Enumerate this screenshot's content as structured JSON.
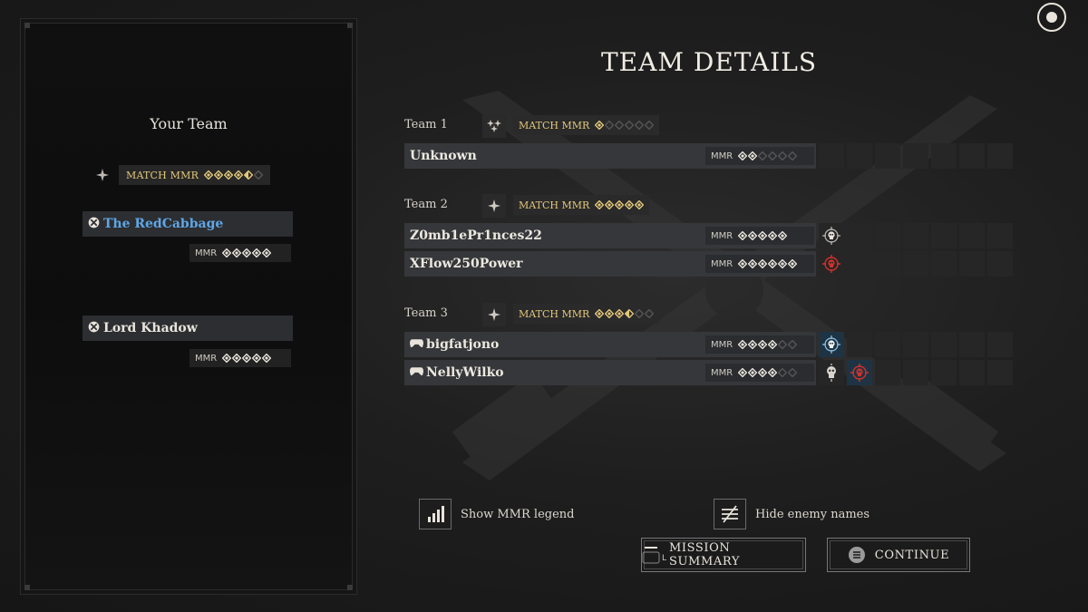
{
  "page": {
    "title": "TEAM DETAILS"
  },
  "your_team": {
    "title": "Your Team",
    "match_mmr_label": "MATCH MMR",
    "match_mmr_stars": 4.5,
    "players": [
      {
        "name": "The RedCabbage",
        "platform": "xbox-icon",
        "highlight": true,
        "mmr_label": "MMR",
        "mmr_stars": 5
      },
      {
        "name": "Lord Khadow",
        "platform": "xbox-icon",
        "highlight": false,
        "mmr_label": "MMR",
        "mmr_stars": 5
      }
    ]
  },
  "teams": [
    {
      "label": "Team 1",
      "match_mmr_label": "MATCH MMR",
      "match_mmr_stars": 1,
      "players": [
        {
          "name": "Unknown",
          "platform": "",
          "mmr_label": "MMR",
          "mmr_stars": 2,
          "slots": []
        }
      ]
    },
    {
      "label": "Team 2",
      "match_mmr_label": "MATCH MMR",
      "match_mmr_stars": 5,
      "players": [
        {
          "name": "Z0mb1ePr1nces22",
          "platform": "",
          "mmr_label": "MMR",
          "mmr_stars": 5,
          "slots": [
            "skull-target-grey-icon"
          ]
        },
        {
          "name": "XFlow250Power",
          "platform": "",
          "mmr_label": "MMR",
          "mmr_stars": 6,
          "slots": [
            "skull-target-red-icon"
          ]
        }
      ]
    },
    {
      "label": "Team 3",
      "match_mmr_label": "MATCH MMR",
      "match_mmr_stars": 3.5,
      "players": [
        {
          "name": "bigfatjono",
          "platform": "gamepad-icon",
          "mmr_label": "MMR",
          "mmr_stars": 4,
          "slots": [
            "skull-target-blue-icon"
          ]
        },
        {
          "name": "NellyWilko",
          "platform": "gamepad-icon",
          "mmr_label": "MMR",
          "mmr_stars": 4,
          "slots": [
            "skull-grey-icon",
            "skull-target-red-icon"
          ]
        }
      ]
    }
  ],
  "toggles": {
    "mmr_legend": {
      "label": "Show MMR legend",
      "icon": "bar-chart-icon"
    },
    "hide_enemy": {
      "label": "Hide enemy names",
      "icon": "list-strike-icon"
    }
  },
  "buttons": {
    "mission_summary": {
      "label": "MISSION SUMMARY",
      "key_hint": "L"
    },
    "continue": {
      "label": "CONTINUE"
    }
  },
  "colors": {
    "gold": "#e2c77a",
    "highlight_blue": "#5fa6e6",
    "enemy_red": "#d3302a"
  }
}
